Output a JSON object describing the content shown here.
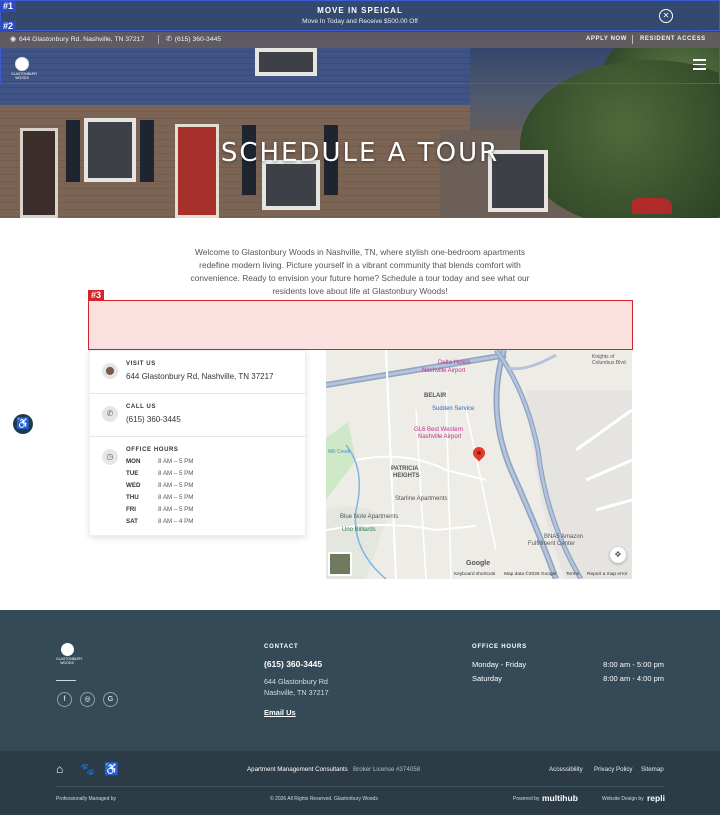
{
  "promo": {
    "title": "MOVE IN SPEICAL",
    "subtitle": "Move In Today and Receive $500.00 Off",
    "close_icon": "close-icon"
  },
  "annotations": {
    "badge1": "#1",
    "badge2": "#2",
    "badge3": "#3"
  },
  "infobar": {
    "address": "644 Glastonbury Rd. Nashville, TN 37217",
    "phone": "(615) 360-3445",
    "apply": "APPLY NOW",
    "resident": "RESIDENT ACCESS"
  },
  "nav": {
    "logo_text": "GLASTONBURY WOODS"
  },
  "hero": {
    "title": "SCHEDULE A TOUR"
  },
  "intro": "Welcome to Glastonbury Woods in Nashville, TN, where stylish one-bedroom apartments redefine modern living. Picture yourself in a vibrant community that blends comfort with convenience. Ready to envision your future home? Schedule a tour today and see what our residents love about life at Glastonbury Woods!",
  "contact": {
    "visit_label": "VISIT US",
    "visit_value": "644 Glastonbury Rd, Nashville, TN 37217",
    "call_label": "CALL US",
    "call_value": "(615) 360-3445",
    "hours_label": "OFFICE HOURS",
    "hours": [
      {
        "day": "MON",
        "time": "8 AM – 5 PM"
      },
      {
        "day": "TUE",
        "time": "8 AM – 5 PM"
      },
      {
        "day": "WED",
        "time": "8 AM – 5 PM"
      },
      {
        "day": "THU",
        "time": "8 AM – 5 PM"
      },
      {
        "day": "FRI",
        "time": "8 AM – 5 PM"
      },
      {
        "day": "SAT",
        "time": "8 AM – 4 PM"
      }
    ]
  },
  "map": {
    "labels": {
      "belair": "BELAIR",
      "patricia": "PATRICIA",
      "heights": "HEIGHTS",
      "delta": "Delta Hotels",
      "delta2": "Nashville Airport",
      "sudden": "Sudden Service",
      "gl6": "GL6 Best Western",
      "gl62": "Nashville Airport",
      "starline": "Starline Apartments",
      "bluenote": "Blue Note Apartments",
      "uno": "Uno Billiards",
      "bna": "BNA5 Amazon",
      "bna2": "Fulfillment Center",
      "mill": "Mill Creek",
      "knights": "Knights of Columbus Blvd",
      "google": "Google"
    },
    "attrib": {
      "shortcuts": "Keyboard shortcuts",
      "data": "Map data ©2026 Google",
      "terms": "Terms",
      "report": "Report a map error"
    }
  },
  "footer": {
    "logo_text": "GLASTONBURY WOODS",
    "contact_head": "CONTACT",
    "phone": "(615) 360-3445",
    "addr1": "644 Glastonbury Rd",
    "addr2": "Nashville, TN 37217",
    "email": "Email Us",
    "hours_head": "OFFICE HOURS",
    "hours": [
      {
        "day": "Monday - Friday",
        "time": "8:00 am - 5:00 pm"
      },
      {
        "day": "Saturday",
        "time": "8:00 am - 4:00 pm"
      }
    ]
  },
  "subfooter": {
    "company": "Apartment Management Consultants",
    "license": "Broker License #374058",
    "links": [
      "Accessibility",
      "Privacy Policy",
      "Sitemap"
    ],
    "managed": "Professionally Managed by",
    "copyright": "© 2026 All Rights Reserved. Glastonbury Woods",
    "powered": "Powered by",
    "multihub": "multihub",
    "design": "Website Design by",
    "repli": "repli"
  },
  "colors": {
    "banner": "#34496f",
    "footer": "#344a57",
    "subfooter": "#2b3c47",
    "annotation_blue": "#2c49c7",
    "annotation_red": "#d4232a"
  }
}
